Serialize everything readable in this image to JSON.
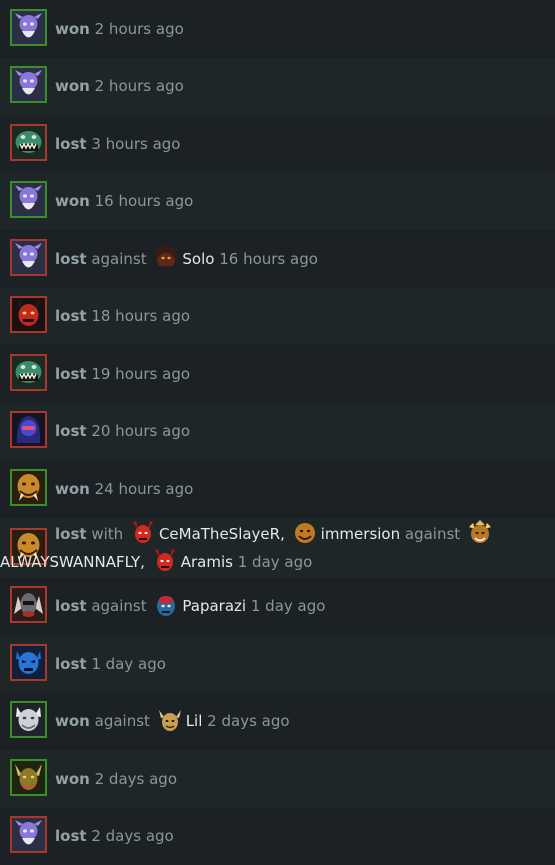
{
  "matches": [
    {
      "hero": "ghost-purple-hero-icon",
      "result": "won",
      "time": "2 hours ago"
    },
    {
      "hero": "ghost-purple-hero-icon",
      "result": "won",
      "time": "2 hours ago"
    },
    {
      "hero": "green-beast-hero-icon",
      "result": "lost",
      "time": "3 hours ago"
    },
    {
      "hero": "ghost-purple-hero-icon",
      "result": "won",
      "time": "16 hours ago"
    },
    {
      "hero": "ghost-purple-hero-icon",
      "result": "lost",
      "against_label": "against",
      "opponent": "Solo",
      "time": "16 hours ago"
    },
    {
      "hero": "red-demon-hero-icon",
      "result": "lost",
      "time": "18 hours ago"
    },
    {
      "hero": "green-beast-hero-icon",
      "result": "lost",
      "time": "19 hours ago"
    },
    {
      "hero": "blue-hooded-hero-icon",
      "result": "lost",
      "time": "20 hours ago"
    },
    {
      "hero": "orange-tusk-hero-icon",
      "result": "won",
      "time": "24 hours ago"
    },
    {
      "hero": "orange-tusk-hero-icon",
      "result": "lost",
      "with_label": "with",
      "ally1": "CeMaTheSlayeR",
      "comma1": ",",
      "ally2": "immersion",
      "against_label": "against",
      "opponent1": "ALWAYSWANNAFLY",
      "comma2": ",",
      "opponent2": "Aramis",
      "time": "1 day ago"
    },
    {
      "hero": "armored-warrior-hero-icon",
      "result": "lost",
      "against_label": "against",
      "opponent": "Paparazi",
      "time": "1 day ago"
    },
    {
      "hero": "blue-mask-hero-icon",
      "result": "lost",
      "time": "1 day ago"
    },
    {
      "hero": "white-wolf-hero-icon",
      "result": "won",
      "against_label": "against",
      "opponent": "Lil",
      "time": "2 days ago"
    },
    {
      "hero": "antler-tree-hero-icon",
      "result": "won",
      "time": "2 days ago"
    },
    {
      "hero": "ghost-purple-hero-icon",
      "result": "lost",
      "time": "2 days ago"
    }
  ],
  "colors": {
    "won_border": "#3a8f2b",
    "lost_border": "#a8382b",
    "row_bg": "#1b2124",
    "row_bg_alt": "#1f2628"
  }
}
